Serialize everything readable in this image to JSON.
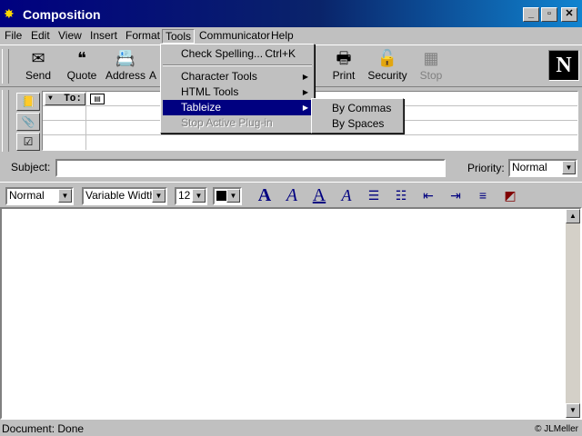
{
  "window": {
    "title": "Composition",
    "min": "_",
    "max": "▫",
    "close": "✕"
  },
  "menubar": [
    "File",
    "Edit",
    "View",
    "Insert",
    "Format",
    "Tools",
    "Communicator",
    "Help"
  ],
  "toolbar": {
    "send": "Send",
    "quote": "Quote",
    "address": "Address",
    "attach_partial": "A",
    "print": "Print",
    "security": "Security",
    "stop": "Stop"
  },
  "address": {
    "type_label": "To:"
  },
  "subject": {
    "label": "Subject:",
    "value": ""
  },
  "priority": {
    "label": "Priority:",
    "value": "Normal"
  },
  "format": {
    "paragraph": "Normal",
    "font": "Variable Width",
    "size": "12",
    "color": "#000000"
  },
  "tools_menu": {
    "check_spelling": "Check Spelling...",
    "check_spelling_shortcut": "Ctrl+K",
    "character_tools": "Character Tools",
    "html_tools": "HTML Tools",
    "tableize": "Tableize",
    "stop_plugin": "Stop Active Plug-in"
  },
  "tableize_menu": {
    "by_commas": "By Commas",
    "by_spaces": "By Spaces"
  },
  "status": {
    "text": "Document: Done",
    "credit": "© JLMeller"
  }
}
